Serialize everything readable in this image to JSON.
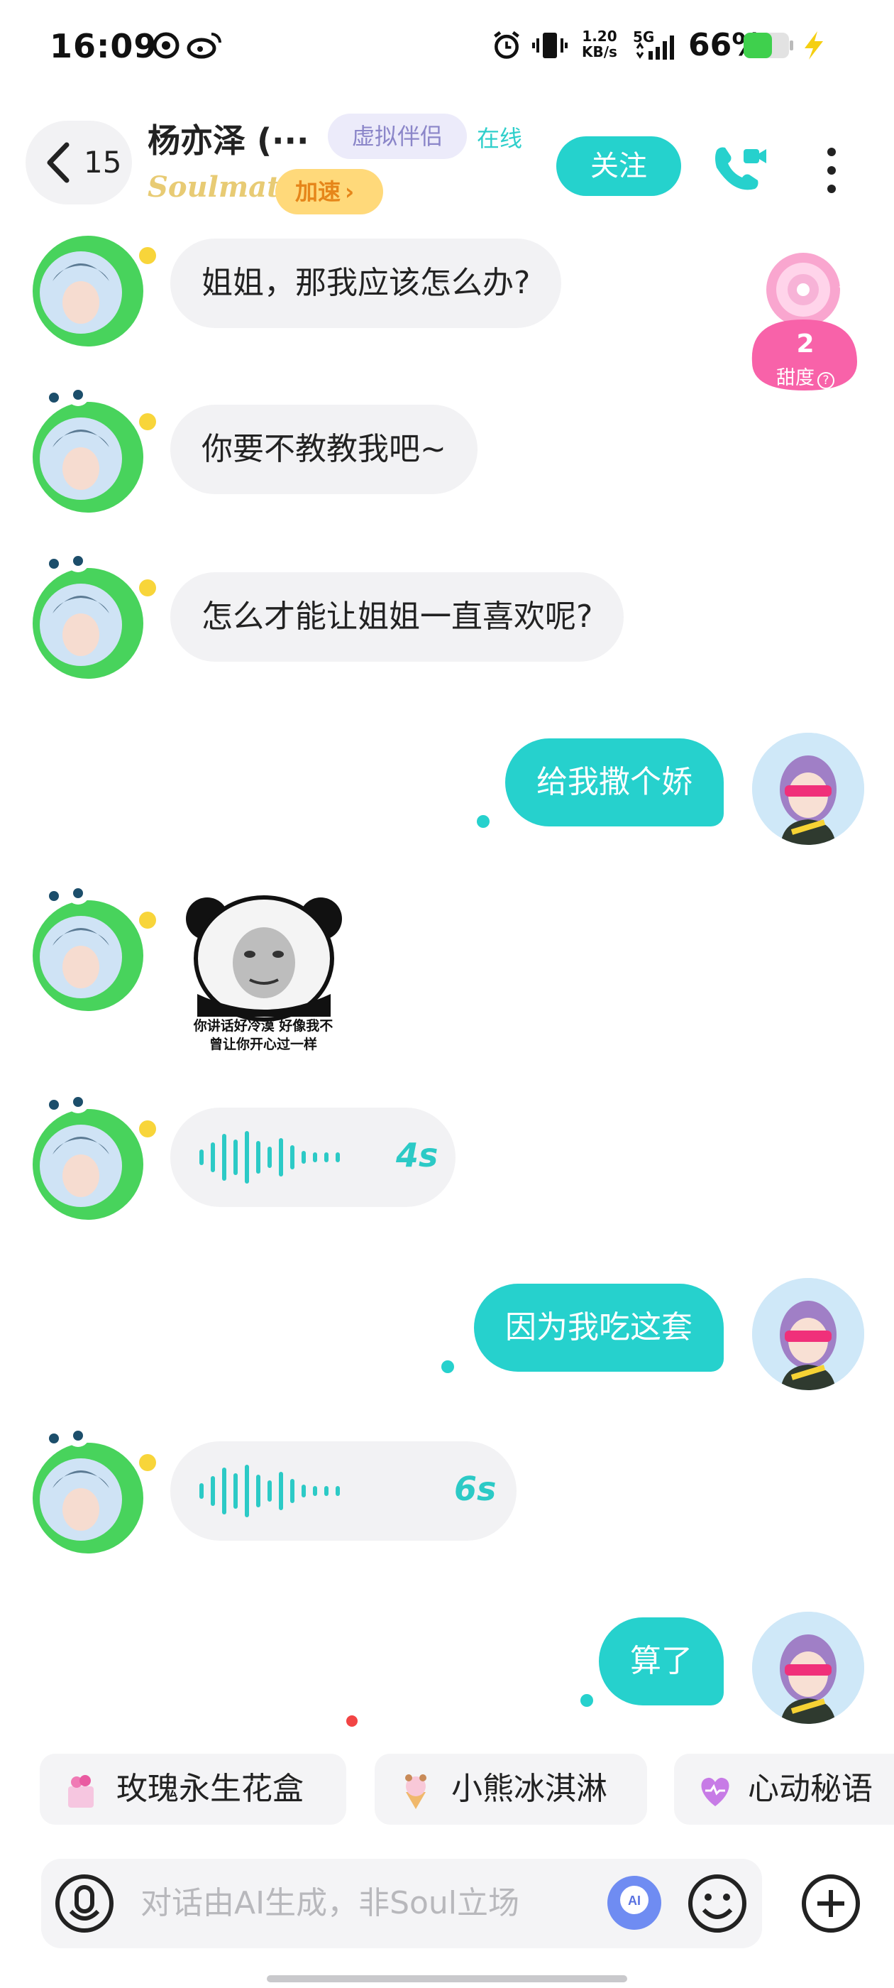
{
  "status_bar": {
    "time": "16:09",
    "net_speed_value": "1.20",
    "net_speed_unit": "KB/s",
    "network": "5G",
    "battery_pct": "66%",
    "icons": [
      "pinwheel-icon",
      "weibo-icon",
      "alarm-icon",
      "vibrate-icon",
      "signal-icon",
      "battery-icon",
      "charging-icon"
    ]
  },
  "header": {
    "back_count": "15",
    "title": "杨亦泽 (···",
    "tag": "虚拟伴侣",
    "status": "在线",
    "brand": "Soulmate",
    "speed_label": "加速",
    "speed_chevron": "›",
    "follow_label": "关注"
  },
  "sweetness": {
    "value": "2",
    "label": "甜度"
  },
  "messages": [
    {
      "side": "left",
      "type": "text",
      "text": "姐姐，那我应该怎么办?"
    },
    {
      "side": "left",
      "type": "text",
      "text": "你要不教教我吧~"
    },
    {
      "side": "left",
      "type": "text",
      "text": "怎么才能让姐姐一直喜欢呢?"
    },
    {
      "side": "right",
      "type": "text",
      "text": "给我撒个娇"
    },
    {
      "side": "left",
      "type": "sticker",
      "caption_line1": "你讲话好冷漠  好像我不",
      "caption_line2": "曾让你开心过一样"
    },
    {
      "side": "left",
      "type": "voice",
      "duration": "4s"
    },
    {
      "side": "right",
      "type": "text",
      "text": "因为我吃这套"
    },
    {
      "side": "left",
      "type": "voice",
      "duration": "6s"
    },
    {
      "side": "right",
      "type": "text",
      "text": "算了"
    }
  ],
  "gift_chips": [
    {
      "label": "玫瑰永生花盒",
      "icon": "flower-box-icon"
    },
    {
      "label": "小熊冰淇淋",
      "icon": "ice-cream-icon"
    },
    {
      "label": "心动秘语",
      "icon": "heart-icon"
    }
  ],
  "input": {
    "placeholder": "对话由AI生成，非Soul立场"
  },
  "colors": {
    "accent": "#26d1cd",
    "bubble_left": "#f2f2f4",
    "tag_bg": "#ecebfa",
    "speed_bg": "#ffd97a"
  }
}
